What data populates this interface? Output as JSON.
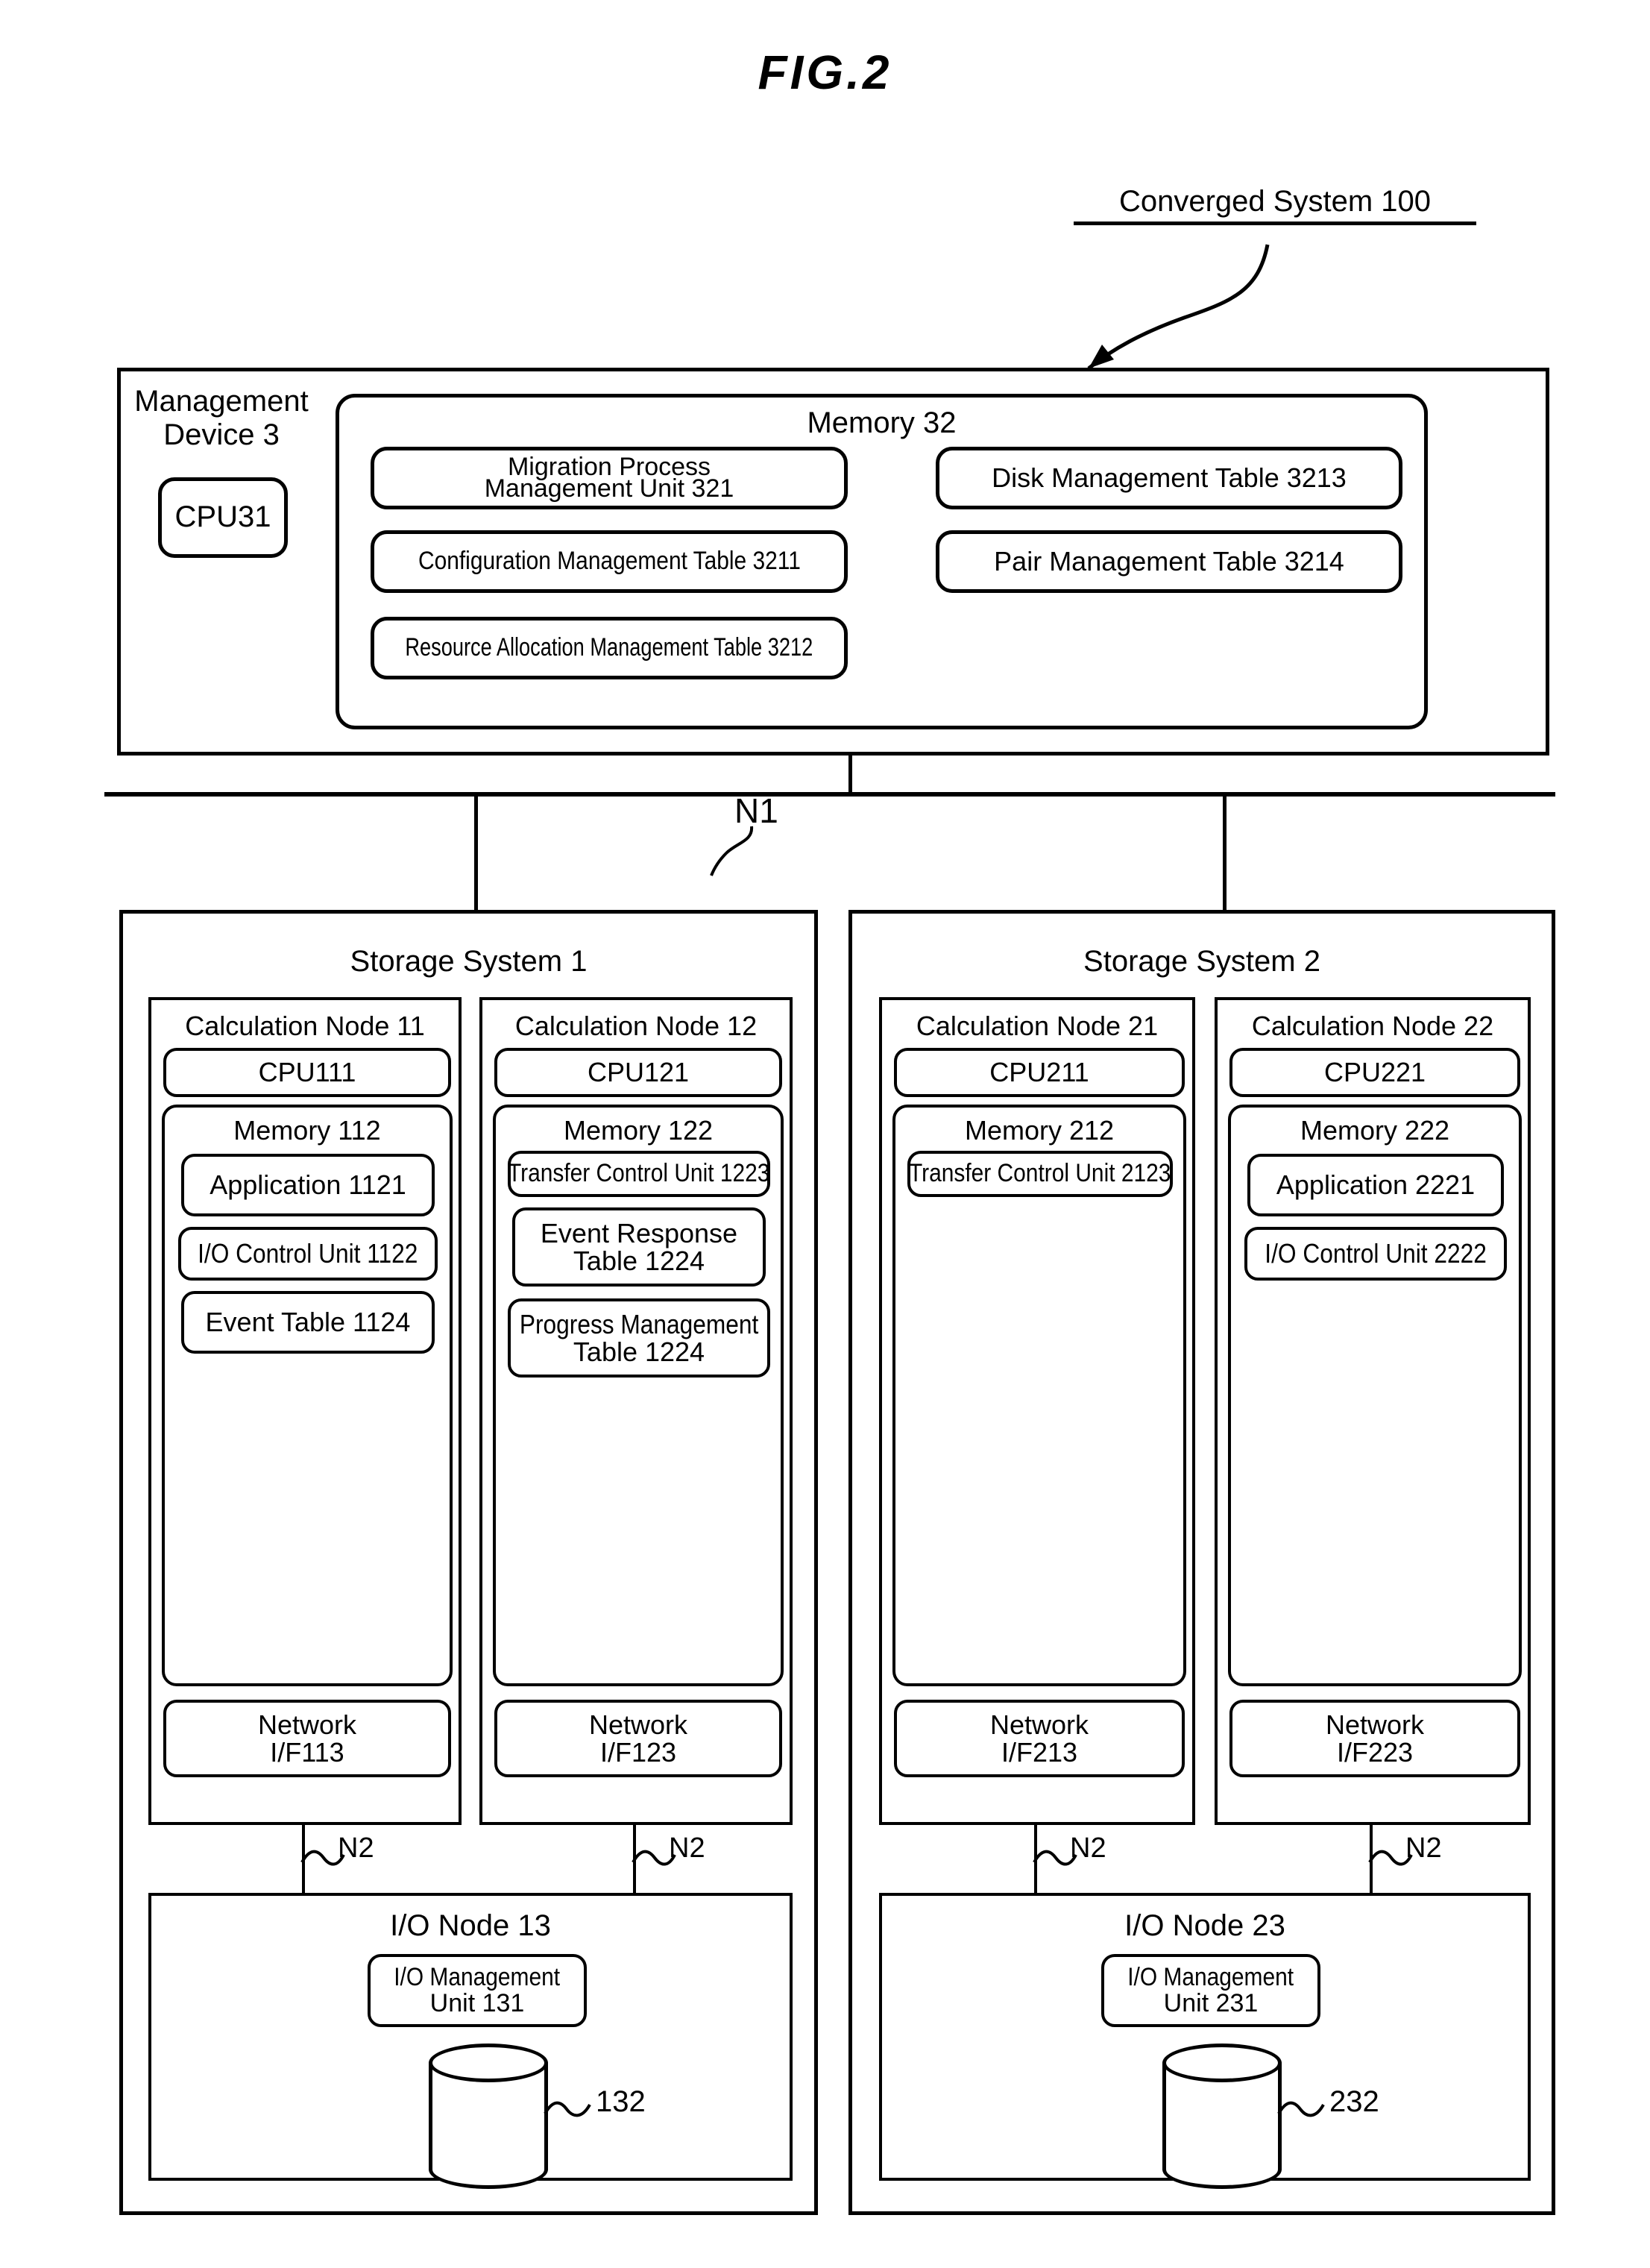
{
  "figure": {
    "title": "FIG.2",
    "system_callout": "Converged System 100"
  },
  "management_device": {
    "label_line1": "Management",
    "label_line2": "Device 3",
    "cpu": "CPU31",
    "memory": {
      "title": "Memory 32",
      "left_items": [
        "Migration Process\nManagement Unit 321",
        "Configuration Management Table 3211",
        "Resource Allocation Management Table 3212"
      ],
      "left_items_text": {
        "migration_l1": "Migration Process",
        "migration_l2": "Management Unit 321",
        "config_table": "Configuration Management Table 3211",
        "resource_table": "Resource Allocation Management Table 3212"
      },
      "right_items_text": {
        "disk_table": "Disk Management Table 3213",
        "pair_table": "Pair Management Table 3214"
      }
    }
  },
  "networks": {
    "n1": "N1",
    "n2": "N2"
  },
  "storage_systems": [
    {
      "title": "Storage System 1",
      "calculation_nodes": [
        {
          "title": "Calculation Node 11",
          "cpu": "CPU111",
          "memory_title": "Memory 112",
          "memory_items": [
            {
              "l1": "Application 1121",
              "l2": ""
            },
            {
              "l1": "I/O Control Unit 1122",
              "l2": ""
            },
            {
              "l1": "Event Table 1124",
              "l2": ""
            }
          ],
          "network_if_l1": "Network",
          "network_if_l2": "I/F113"
        },
        {
          "title": "Calculation Node 12",
          "cpu": "CPU121",
          "memory_title": "Memory 122",
          "memory_items": [
            {
              "l1": "Transfer Control Unit 1223",
              "l2": ""
            },
            {
              "l1": "Event Response",
              "l2": "Table 1224"
            },
            {
              "l1": "Progress Management",
              "l2": "Table 1224"
            }
          ],
          "network_if_l1": "Network",
          "network_if_l2": "I/F123"
        }
      ],
      "io_node": {
        "title": "I/O Node 13",
        "unit_l1": "I/O Management",
        "unit_l2": "Unit 131",
        "disk_ref": "132"
      }
    },
    {
      "title": "Storage System 2",
      "calculation_nodes": [
        {
          "title": "Calculation Node 21",
          "cpu": "CPU211",
          "memory_title": "Memory 212",
          "memory_items": [
            {
              "l1": "Transfer Control Unit 2123",
              "l2": ""
            }
          ],
          "network_if_l1": "Network",
          "network_if_l2": "I/F213"
        },
        {
          "title": "Calculation Node 22",
          "cpu": "CPU221",
          "memory_title": "Memory 222",
          "memory_items": [
            {
              "l1": "Application 2221",
              "l2": ""
            },
            {
              "l1": "I/O Control Unit 2222",
              "l2": ""
            }
          ],
          "network_if_l1": "Network",
          "network_if_l2": "I/F223"
        }
      ],
      "io_node": {
        "title": "I/O Node 23",
        "unit_l1": "I/O Management",
        "unit_l2": "Unit 231",
        "disk_ref": "232"
      }
    }
  ],
  "colors": {
    "line": "#000000",
    "background": "#ffffff"
  }
}
